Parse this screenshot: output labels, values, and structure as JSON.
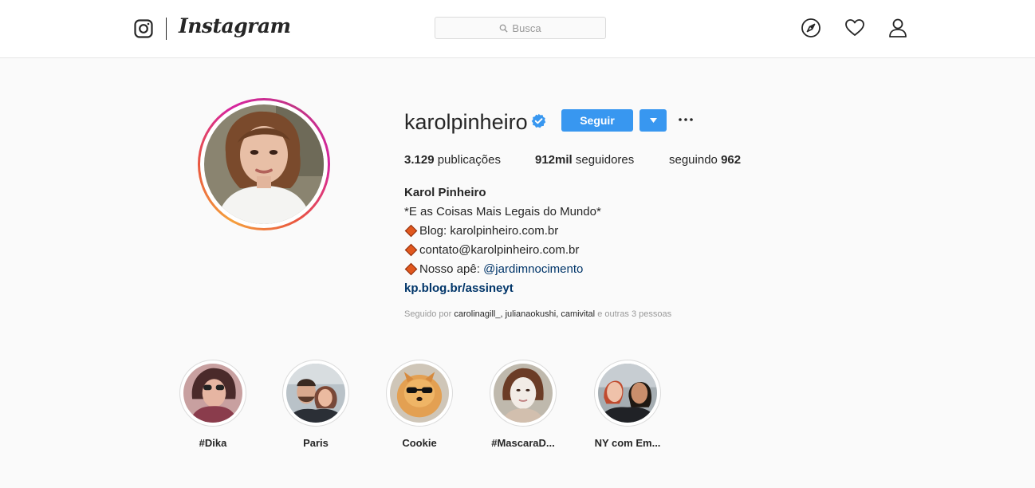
{
  "header": {
    "brand": "Instagram",
    "search_placeholder": "Busca",
    "icons": [
      "instagram-logo-icon",
      "explore-compass-icon",
      "activity-heart-icon",
      "profile-person-icon"
    ]
  },
  "profile": {
    "username": "karolpinheiro",
    "verified": true,
    "follow_label": "Seguir",
    "stats": {
      "posts_count": "3.129",
      "posts_label": "publicações",
      "followers_count": "912mil",
      "followers_label": "seguidores",
      "following_label": "seguindo",
      "following_count": "962"
    },
    "bio": {
      "name": "Karol Pinheiro",
      "line1": "*E as Coisas Mais Legais do Mundo*",
      "line2": "Blog: karolpinheiro.com.br",
      "line3": "contato@karolpinheiro.com.br",
      "line4_prefix": "Nosso apê:",
      "line4_mention": "@jardimnocimento",
      "link": "kp.blog.br/assineyt"
    },
    "followed_by": {
      "prefix": "Seguido por",
      "user1": "carolinagill_,",
      "user2": "julianaokushi,",
      "user3": "camivital",
      "suffix": "e outras 3 pessoas"
    }
  },
  "highlights": [
    {
      "label": "#Dika"
    },
    {
      "label": "Paris"
    },
    {
      "label": "Cookie"
    },
    {
      "label": "#MascaraD..."
    },
    {
      "label": "NY com Em..."
    }
  ],
  "colors": {
    "accent": "#3897f0",
    "link": "#003569",
    "muted": "#999999",
    "ring_start": "#f5a03c",
    "ring_end": "#c13584"
  }
}
